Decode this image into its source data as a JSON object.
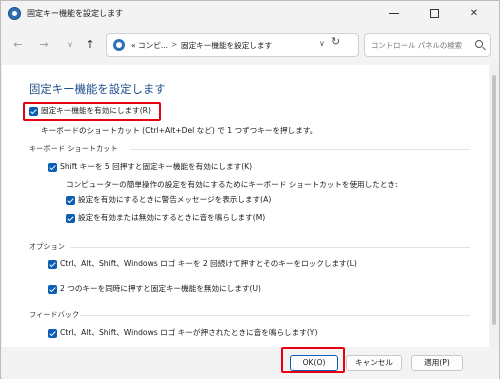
{
  "window": {
    "title": "固定キー機能を設定します"
  },
  "address": {
    "crumb_1": "« コンピ...",
    "separator": ">",
    "crumb_2": "固定キー機能を設定します"
  },
  "search": {
    "placeholder": "コントロール パネルの検索"
  },
  "page": {
    "title": "固定キー機能を設定します",
    "main_checkbox": {
      "label": "固定キー機能を有効にします(R)",
      "checked": true
    },
    "main_description": "キーボードのショートカット (Ctrl+Alt+Del など) で 1 つずつキーを押します。"
  },
  "keyboard_shortcut": {
    "heading": "キーボード ショートカット",
    "shift_five": {
      "label": "Shift キーを 5 回押すと固定キー機能を有効にします(K)",
      "checked": true
    },
    "note": "コンピューターの簡単操作の設定を有効にするためにキーボード ショートカットを使用したとき:",
    "warning_message": {
      "label": "設定を有効にするときに警告メッセージを表示します(A)",
      "checked": true
    },
    "sound": {
      "label": "設定を有効または無効にするときに音を鳴らします(M)",
      "checked": true
    }
  },
  "options": {
    "heading": "オプション",
    "lock_modifier": {
      "label": "Ctrl、Alt、Shift、Windows ロゴ キーを 2 回続けて押すとそのキーをロックします(L)",
      "checked": true
    },
    "two_keys_off": {
      "label": "2 つのキーを同時に押すと固定キー機能を無効にします(U)",
      "checked": true
    }
  },
  "feedback": {
    "heading": "フィードバック",
    "beep": {
      "label": "Ctrl、Alt、Shift、Windows ロゴ キーが押されたときに音を鳴らします(Y)",
      "checked": true
    }
  },
  "footer": {
    "ok": "OK(O)",
    "cancel": "キャンセル",
    "apply": "適用(P)"
  },
  "colors": {
    "accent": "#0a5fb4",
    "title_blue": "#1e4e8c",
    "highlight_red": "#e60012"
  }
}
